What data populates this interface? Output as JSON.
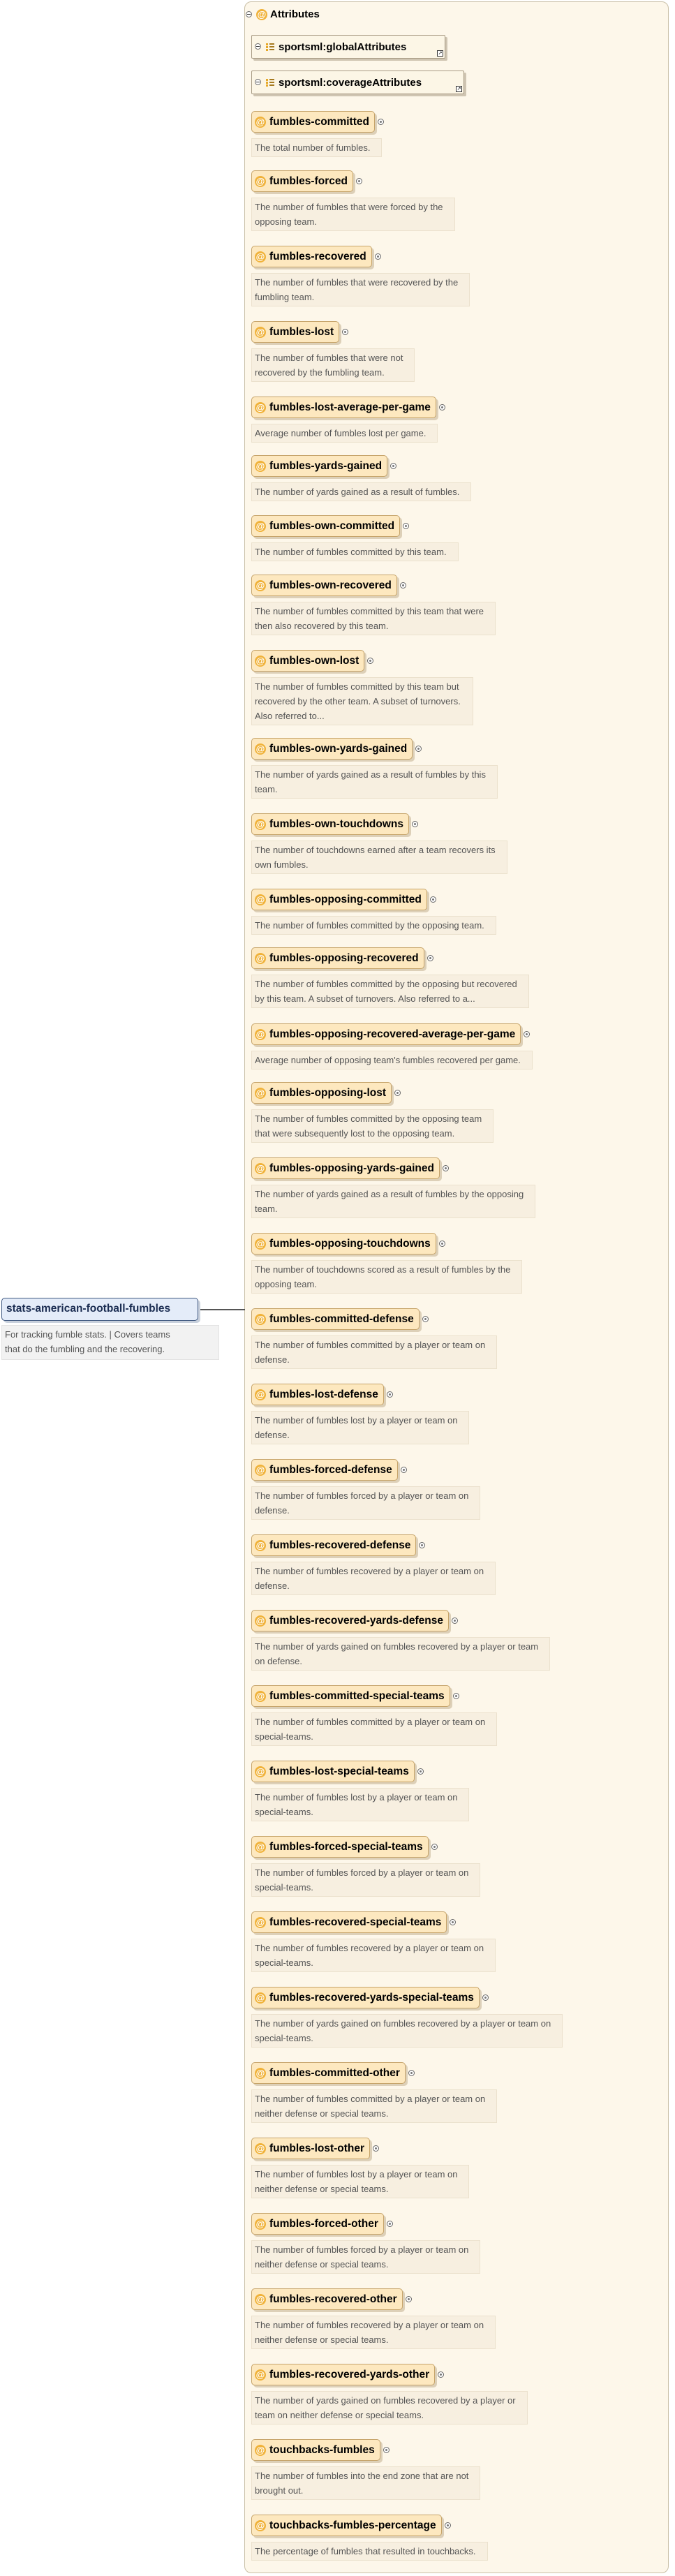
{
  "root": {
    "name": "stats-american-football-fumbles",
    "description_lines": [
      "For tracking fumble stats. | Covers teams",
      "that do the fumbling and the recovering."
    ]
  },
  "attributes_panel": {
    "header": "Attributes",
    "groups": [
      {
        "name": "sportsml:globalAttributes"
      },
      {
        "name": "sportsml:coverageAttributes"
      }
    ],
    "attributes": [
      {
        "name": "fumbles-committed",
        "desc": [
          "The total number of fumbles."
        ]
      },
      {
        "name": "fumbles-forced",
        "desc": [
          "The number of fumbles that were forced by the",
          "opposing team."
        ]
      },
      {
        "name": "fumbles-recovered",
        "desc": [
          "The number of fumbles that were recovered by the",
          "fumbling team."
        ]
      },
      {
        "name": "fumbles-lost",
        "desc": [
          "The number of fumbles that were not",
          "recovered by the fumbling team."
        ]
      },
      {
        "name": "fumbles-lost-average-per-game",
        "desc": [
          "Average number of fumbles lost per game."
        ]
      },
      {
        "name": "fumbles-yards-gained",
        "desc": [
          "The number of yards gained as a result of fumbles."
        ]
      },
      {
        "name": "fumbles-own-committed",
        "desc": [
          "The number of fumbles committed by this team."
        ]
      },
      {
        "name": "fumbles-own-recovered",
        "desc": [
          "The number of fumbles committed by this team that were",
          "then also recovered by this team."
        ]
      },
      {
        "name": "fumbles-own-lost",
        "desc": [
          "The number of fumbles committed by this team but",
          "recovered by the other team. A subset of turnovers.",
          "Also referred to..."
        ]
      },
      {
        "name": "fumbles-own-yards-gained",
        "desc": [
          "The number of yards gained as a result of fumbles by this",
          "team."
        ]
      },
      {
        "name": "fumbles-own-touchdowns",
        "desc": [
          "The number of touchdowns earned after a team recovers its",
          "own fumbles."
        ]
      },
      {
        "name": "fumbles-opposing-committed",
        "desc": [
          "The number of fumbles committed by the opposing team."
        ]
      },
      {
        "name": "fumbles-opposing-recovered",
        "desc": [
          "The number of fumbles committed by the opposing but recovered",
          "by this team. A subset of turnovers. Also referred to a..."
        ]
      },
      {
        "name": "fumbles-opposing-recovered-average-per-game",
        "desc": [
          "Average number of opposing team's fumbles recovered per game."
        ]
      },
      {
        "name": "fumbles-opposing-lost",
        "desc": [
          "The number of fumbles committed by the opposing team",
          "that were subsequently lost to the opposing team."
        ]
      },
      {
        "name": "fumbles-opposing-yards-gained",
        "desc": [
          "The number of yards gained as a result of fumbles by the opposing",
          "team."
        ]
      },
      {
        "name": "fumbles-opposing-touchdowns",
        "desc": [
          "The number of touchdowns scored as a result of fumbles by the",
          "opposing team."
        ]
      },
      {
        "name": "fumbles-committed-defense",
        "desc": [
          "The number of fumbles committed by a player or team on",
          "defense."
        ]
      },
      {
        "name": "fumbles-lost-defense",
        "desc": [
          "The number of fumbles lost by a player or team on",
          "defense."
        ]
      },
      {
        "name": "fumbles-forced-defense",
        "desc": [
          "The number of fumbles forced by a player or team on",
          "defense."
        ]
      },
      {
        "name": "fumbles-recovered-defense",
        "desc": [
          "The number of fumbles recovered by a player or team on",
          "defense."
        ]
      },
      {
        "name": "fumbles-recovered-yards-defense",
        "desc": [
          "The number of yards gained on fumbles recovered by a player or team",
          "on defense."
        ]
      },
      {
        "name": "fumbles-committed-special-teams",
        "desc": [
          "The number of fumbles committed by a player or team on",
          "special-teams."
        ]
      },
      {
        "name": "fumbles-lost-special-teams",
        "desc": [
          "The number of fumbles lost by a player or team on",
          "special-teams."
        ]
      },
      {
        "name": "fumbles-forced-special-teams",
        "desc": [
          "The number of fumbles forced by a player or team on",
          "special-teams."
        ]
      },
      {
        "name": "fumbles-recovered-special-teams",
        "desc": [
          "The number of fumbles recovered by a player or team on",
          "special-teams."
        ]
      },
      {
        "name": "fumbles-recovered-yards-special-teams",
        "desc": [
          "The number of yards gained on fumbles recovered by a player or team on",
          "special-teams."
        ]
      },
      {
        "name": "fumbles-committed-other",
        "desc": [
          "The number of fumbles committed by a player or team on",
          "neither defense or special teams."
        ]
      },
      {
        "name": "fumbles-lost-other",
        "desc": [
          "The number of fumbles lost by a player or team on",
          "neither defense or special teams."
        ]
      },
      {
        "name": "fumbles-forced-other",
        "desc": [
          "The number of fumbles forced by a player or team on",
          "neither defense or special teams."
        ]
      },
      {
        "name": "fumbles-recovered-other",
        "desc": [
          "The number of fumbles recovered by a player or team on",
          "neither defense or special teams."
        ]
      },
      {
        "name": "fumbles-recovered-yards-other",
        "desc": [
          "The number of yards gained on fumbles recovered by a player or",
          "team on neither defense or special teams."
        ]
      },
      {
        "name": "touchbacks-fumbles",
        "desc": [
          "The number of fumbles into the end zone that are not",
          "brought out."
        ]
      },
      {
        "name": "touchbacks-fumbles-percentage",
        "desc": [
          "The percentage of fumbles that resulted in touchbacks."
        ]
      }
    ]
  }
}
